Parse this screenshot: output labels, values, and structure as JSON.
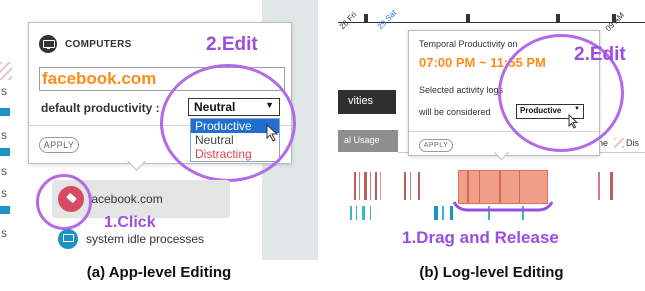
{
  "panel_a": {
    "popup_header": "COMPUTERS",
    "app_name_input": "facebook.com",
    "productivity_label": "default productivity :",
    "selected_value": "Neutral",
    "options": [
      "Productive",
      "Neutral",
      "Distracting"
    ],
    "apply_label": "APPLY",
    "list_items": [
      "facebook.com",
      "system idle processes"
    ],
    "left_stub_letter": "s",
    "step_edit": "2.Edit",
    "step_click": "1.Click",
    "caption": "(a) App-level Editing",
    "colors": {
      "accent_orange": "#ff8c1a",
      "annotation_purple": "#9b4fe0",
      "productive_blue": "#1f6fd1",
      "distracting_red": "#e0424c",
      "app_icon": "#d84a64",
      "monitor_icon": "#1b93c4"
    }
  },
  "panel_b": {
    "axis_ticks": [
      "28 Fri",
      "29 Sat",
      "09 AM"
    ],
    "popup_title": "Temporal Productivity on",
    "time_range": "07:00 PM ~ 11:55 PM",
    "body_line1": "Selected activity logs",
    "body_line2": "will be considered",
    "selected_value": "Productive",
    "apply_label": "APPLY",
    "tab_label": "vities",
    "usage_label": "al Usage",
    "legend_fragment": "ne",
    "legend_dis": "Dis",
    "step_edit": "2.Edit",
    "step_drag": "1.Drag and Release",
    "caption": "(b) Log-level Editing",
    "colors": {
      "selection_fill": "#f0a088",
      "selection_border": "#e07255",
      "log_red": "#b86060",
      "log_teal": "#39b6c8"
    }
  }
}
